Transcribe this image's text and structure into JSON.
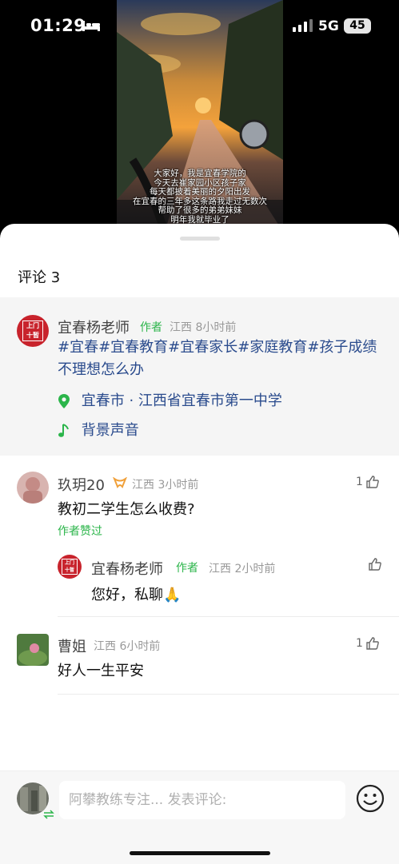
{
  "status_bar": {
    "time": "01:29",
    "network": "5G",
    "battery": "45"
  },
  "video": {
    "subtitle_lines": [
      "大家好，我是宜春学院的",
      "今天去崔家园小区孩子家",
      "每天都披着美丽的夕阳出发",
      "在宜春的三年多这条路我走过无数次",
      "帮助了很多的弟弟妹妹",
      "明年我就毕业了"
    ]
  },
  "comments_header": {
    "label": "评论 3"
  },
  "author_post": {
    "avatar_text": "上门 十暂",
    "name": "宜春杨老师",
    "author_tag": "作者",
    "meta": "江西 8小时前",
    "hashtags": "#宜春#宜春教育#宜春家长#家庭教育#孩子成绩不理想怎么办",
    "location": "宜春市 · 江西省宜春市第一中学",
    "music": "背景声音"
  },
  "comments": [
    {
      "name": "玖玥20",
      "meta": "江西 3小时前",
      "text": "教初二学生怎么收费?",
      "likes": "1",
      "liked_by_author": "作者赞过"
    },
    {
      "name": "曹姐",
      "meta": "江西 6小时前",
      "text": "好人一生平安",
      "likes": "1"
    }
  ],
  "reply": {
    "name": "宜春杨老师",
    "author_tag": "作者",
    "meta": "江西 2小时前",
    "text": "您好，私聊🙏"
  },
  "composer": {
    "placeholder": "阿攀教练专注... 发表评论:"
  },
  "colors": {
    "author_green": "#2bb54a",
    "link_blue": "#2a4b8d",
    "avatar_red": "#c8232c"
  }
}
